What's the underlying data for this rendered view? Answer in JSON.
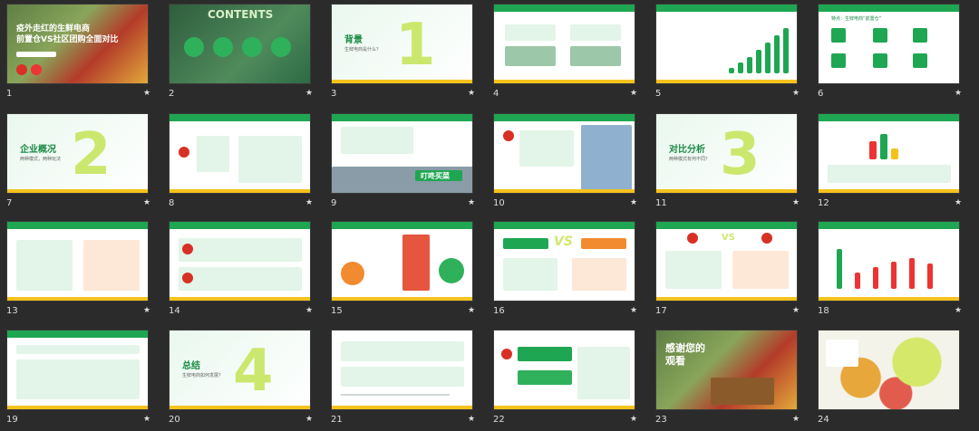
{
  "slides": [
    {
      "n": "1",
      "title_l1": "疫外走红的生鲜电商",
      "title_l2": "前置仓VS社区团购全面对比"
    },
    {
      "n": "2",
      "title": "CONTENTS"
    },
    {
      "n": "3",
      "section": "背景",
      "section_sub": "生鲜电商是什么？",
      "digit": "1"
    },
    {
      "n": "4"
    },
    {
      "n": "5"
    },
    {
      "n": "6",
      "head": "特点：生鲜电商“前置仓”"
    },
    {
      "n": "7",
      "section": "企业概况",
      "section_sub": "两种模式，两种玩法",
      "digit": "2"
    },
    {
      "n": "8"
    },
    {
      "n": "9",
      "store_sign": "叮咚买菜"
    },
    {
      "n": "10"
    },
    {
      "n": "11",
      "section": "对比分析",
      "section_sub": "两种模式有何不同？",
      "digit": "3"
    },
    {
      "n": "12"
    },
    {
      "n": "13"
    },
    {
      "n": "14"
    },
    {
      "n": "15"
    },
    {
      "n": "16",
      "vs": "VS"
    },
    {
      "n": "17",
      "vs": "VS"
    },
    {
      "n": "18"
    },
    {
      "n": "19"
    },
    {
      "n": "20",
      "section": "总结",
      "section_sub": "生鲜电商如何发展？",
      "digit": "4"
    },
    {
      "n": "21"
    },
    {
      "n": "22"
    },
    {
      "n": "23",
      "title_l1": "感谢您的",
      "title_l2": "观看"
    },
    {
      "n": "24"
    }
  ],
  "star_glyph": "★",
  "colors": {
    "accent": "#1fa652",
    "yellow": "#f4c21c",
    "red": "#d93025",
    "bg": "#2b2b2b"
  }
}
